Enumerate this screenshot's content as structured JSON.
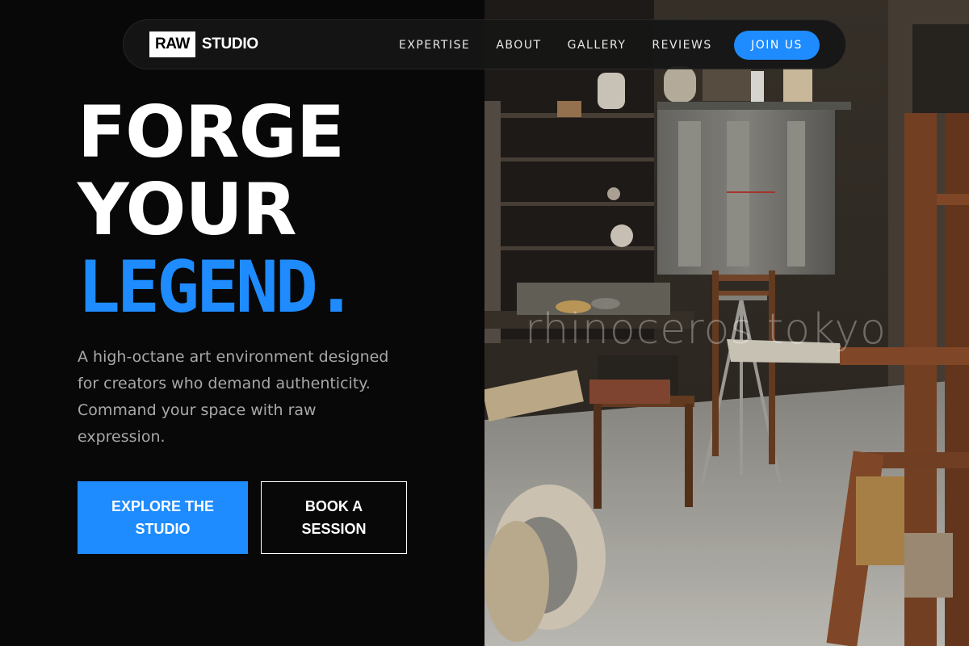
{
  "nav": {
    "logo_box": "RAW",
    "logo_text": "STUDIO",
    "links": [
      "EXPERTISE",
      "ABOUT",
      "GALLERY",
      "REVIEWS"
    ],
    "cta": "JOIN US"
  },
  "hero": {
    "title_line1": "FORGE",
    "title_line2": "YOUR",
    "title_line3": "LEGEND.",
    "description": "A high-octane art environment designed for creators who demand authenticity. Command your space with raw expression.",
    "primary_button": "EXPLORE THE STUDIO",
    "secondary_button": "BOOK A SESSION"
  },
  "image": {
    "watermark": "rhinoceros tokyo"
  },
  "colors": {
    "accent": "#1e8bff",
    "background": "#080808",
    "text": "#ffffff",
    "muted_text": "#a8a8a8"
  }
}
